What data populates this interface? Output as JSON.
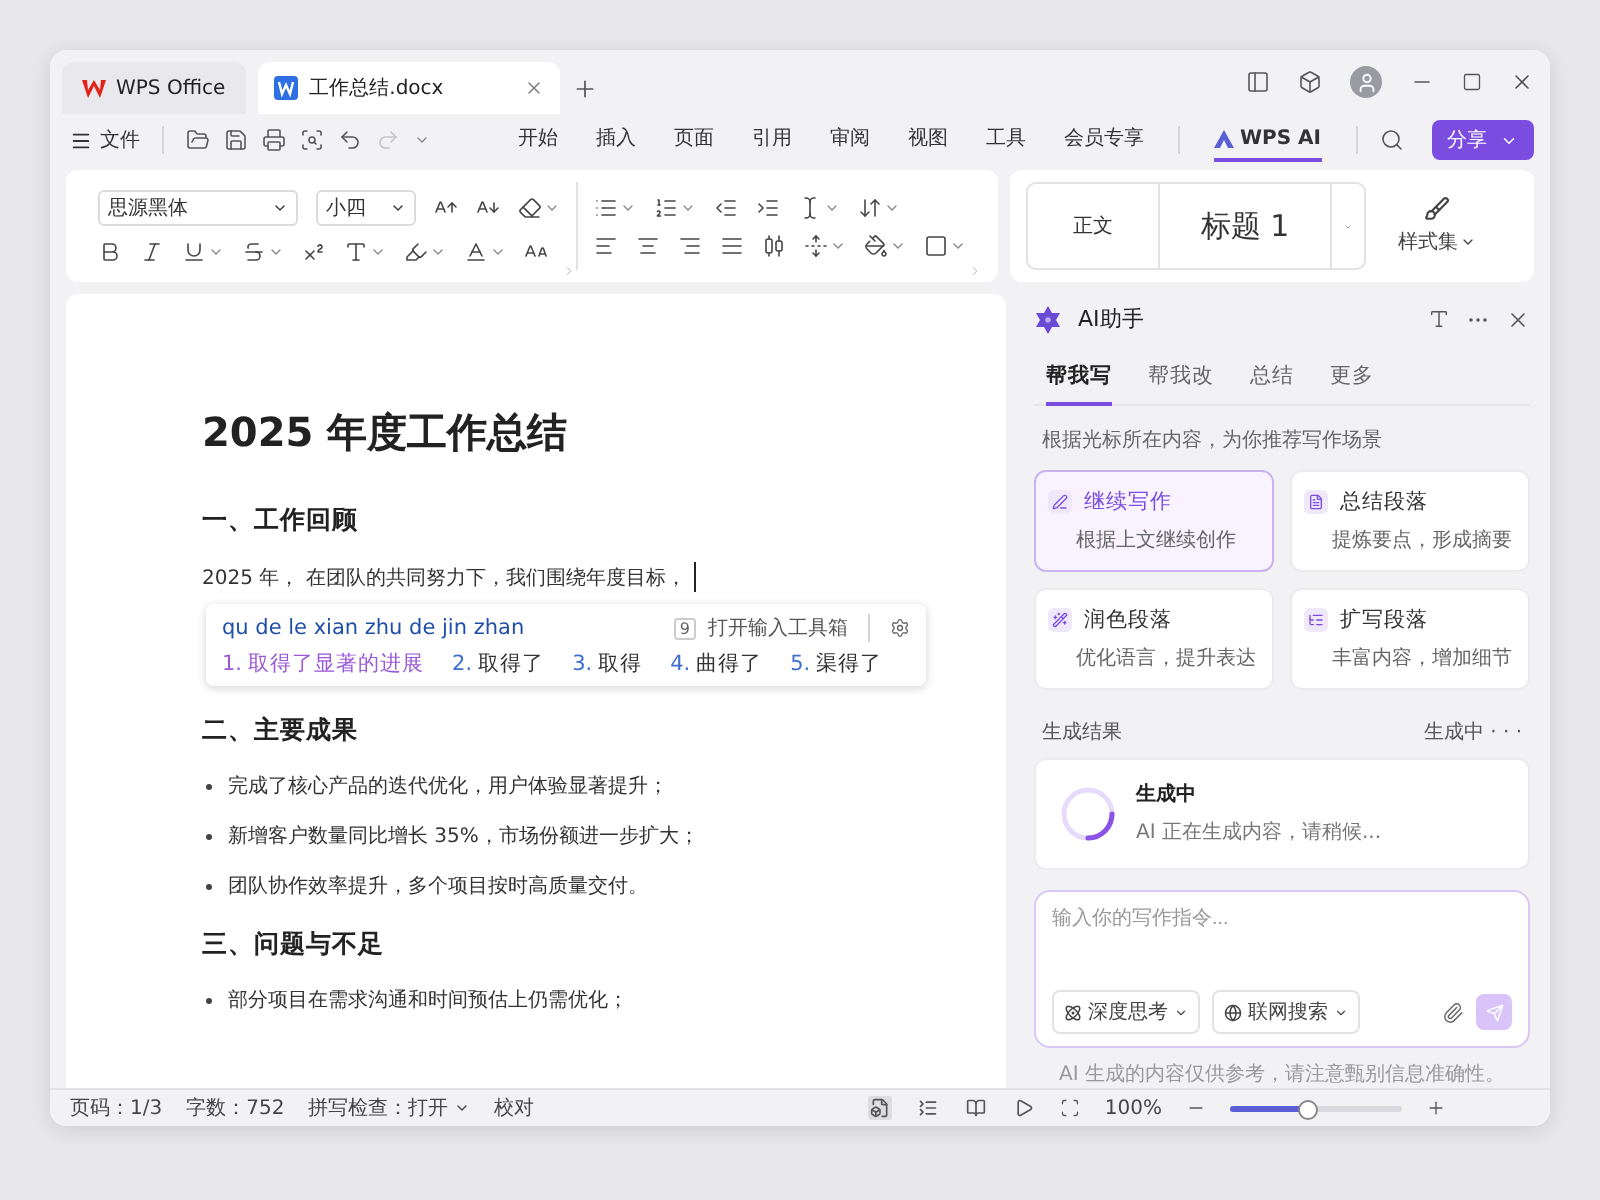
{
  "title_bar": {
    "app_tab": "WPS Office",
    "doc_tab": {
      "label": "工作总结.docx",
      "selected": true
    }
  },
  "menu": {
    "file": "文件",
    "redo": {
      "disabled": true
    },
    "items": [
      {
        "label": "开始",
        "selected": false,
        "kind": "text"
      },
      {
        "label": "插入",
        "selected": false,
        "kind": "text"
      },
      {
        "label": "页面",
        "selected": false,
        "kind": "text"
      },
      {
        "label": "引用",
        "selected": false,
        "kind": "text"
      },
      {
        "label": "审阅",
        "selected": false,
        "kind": "text"
      },
      {
        "label": "视图",
        "selected": false,
        "kind": "text"
      },
      {
        "label": "工具",
        "selected": false,
        "kind": "text"
      },
      {
        "label": "会员专享",
        "selected": false,
        "kind": "text"
      },
      {
        "label": "WPS AI",
        "selected": true,
        "kind": "ai"
      }
    ],
    "share": "分享"
  },
  "ribbon": {
    "font": "思源黑体",
    "size": "小四",
    "styles": [
      {
        "label": "正文",
        "kind": "body"
      },
      {
        "label": "标题 1",
        "kind": "heading"
      }
    ],
    "style_set": "样式集"
  },
  "document": {
    "title": "2025 年度工作总结",
    "blocks": [
      {
        "kind": "heading",
        "text": "一、工作回顾"
      },
      {
        "kind": "paragraph",
        "text": "2025 年， 在团队的共同努力下，我们围绕年度目标，",
        "caret": true
      },
      {
        "kind": "heading",
        "text": "二、主要成果"
      },
      {
        "kind": "bullet",
        "text": "完成了核心产品的迭代优化，用户体验显著提升；"
      },
      {
        "kind": "bullet",
        "text": "新增客户数量同比增长 35%，市场份额进一步扩大；"
      },
      {
        "kind": "bullet",
        "text": "团队协作效率提升，多个项目按时高质量交付。"
      },
      {
        "kind": "heading",
        "text": "三、问题与不足"
      },
      {
        "kind": "bullet",
        "text": "部分项目在需求沟通和时间预估上仍需优化；"
      }
    ]
  },
  "ime": {
    "pinyin": "qu de le xian zhu de jin zhan",
    "toolbox_key": "9",
    "toolbox": "打开输入工具箱",
    "candidates": [
      {
        "index": "1.",
        "text": "取得了显著的进展",
        "selected": true
      },
      {
        "index": "2.",
        "text": "取得了",
        "selected": false
      },
      {
        "index": "3.",
        "text": "取得",
        "selected": false
      },
      {
        "index": "4.",
        "text": "曲得了",
        "selected": false
      },
      {
        "index": "5.",
        "text": "渠得了",
        "selected": false
      }
    ]
  },
  "ai_panel": {
    "title": "AI助手",
    "tabs": [
      {
        "label": "帮我写",
        "selected": true
      },
      {
        "label": "帮我改",
        "selected": false
      },
      {
        "label": "总结",
        "selected": false
      },
      {
        "label": "更多",
        "selected": false
      }
    ],
    "hint": "根据光标所在内容，为你推荐写作场景",
    "cards": [
      {
        "kind": "continue",
        "title": "继续写作",
        "desc": "根据上文继续创作",
        "selected": true
      },
      {
        "kind": "summary",
        "title": "总结段落",
        "desc": "提炼要点，形成摘要",
        "selected": false
      },
      {
        "kind": "polish",
        "title": "润色段落",
        "desc": "优化语言，提升表达",
        "selected": false
      },
      {
        "kind": "expand",
        "title": "扩写段落",
        "desc": "丰富内容，增加细节",
        "selected": false
      }
    ],
    "result_label": "生成结果",
    "result_status": "生成中 · · ·",
    "progress": {
      "title": "生成中",
      "desc": "AI 正在生成内容，请稍候..."
    },
    "input": {
      "placeholder": "输入你的写作指令..."
    },
    "chips": [
      {
        "kind": "think",
        "label": "深度思考"
      },
      {
        "kind": "web",
        "label": "联网搜索"
      }
    ],
    "disclaimer": "AI 生成的内容仅供参考，请注意甄别信息准确性。"
  },
  "status_bar": {
    "page": "页码：1/3",
    "words": "字数：752",
    "spell": "拼写检查：打开",
    "proof": "校对",
    "views": [
      {
        "kind": "page",
        "selected": true
      },
      {
        "kind": "outline",
        "selected": false
      },
      {
        "kind": "reading",
        "selected": false
      },
      {
        "kind": "play",
        "selected": false
      }
    ],
    "zoom": {
      "reading": "100%",
      "level": 0.45
    }
  }
}
